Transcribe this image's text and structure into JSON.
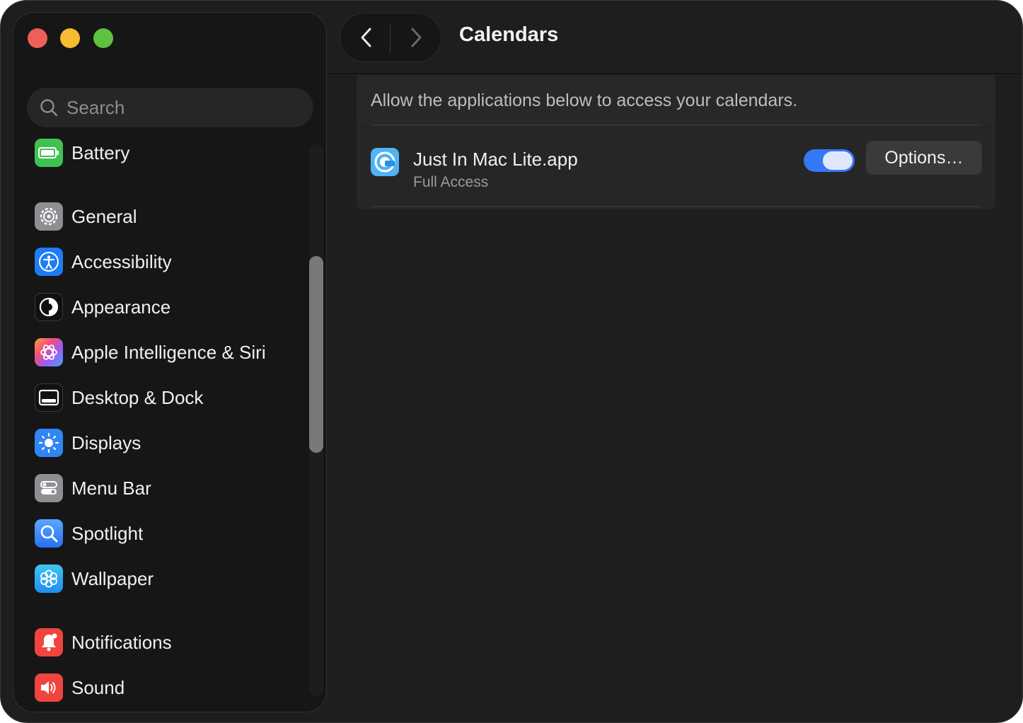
{
  "window": {
    "title": "Calendars"
  },
  "search": {
    "placeholder": "Search"
  },
  "sidebar": {
    "items": [
      {
        "label": "Battery",
        "icon": "battery-icon"
      },
      {
        "label": "General",
        "icon": "gear-icon"
      },
      {
        "label": "Accessibility",
        "icon": "accessibility-icon"
      },
      {
        "label": "Appearance",
        "icon": "appearance-icon"
      },
      {
        "label": "Apple Intelligence & Siri",
        "icon": "siri-icon"
      },
      {
        "label": "Desktop & Dock",
        "icon": "dock-icon"
      },
      {
        "label": "Displays",
        "icon": "sun-icon"
      },
      {
        "label": "Menu Bar",
        "icon": "menu-bar-icon"
      },
      {
        "label": "Spotlight",
        "icon": "magnifier-icon"
      },
      {
        "label": "Wallpaper",
        "icon": "flower-icon"
      },
      {
        "label": "Notifications",
        "icon": "bell-icon"
      },
      {
        "label": "Sound",
        "icon": "speaker-icon"
      }
    ]
  },
  "main": {
    "description": "Allow the applications below to access your calendars.",
    "apps": [
      {
        "name": "Just In Mac Lite.app",
        "status": "Full Access",
        "enabled": true,
        "options_label": "Options…",
        "icon": "just-in-mac-icon"
      }
    ]
  },
  "colors": {
    "accent": "#3478f6",
    "window_bg": "#1e1e1e",
    "sidebar_bg": "#161616"
  }
}
